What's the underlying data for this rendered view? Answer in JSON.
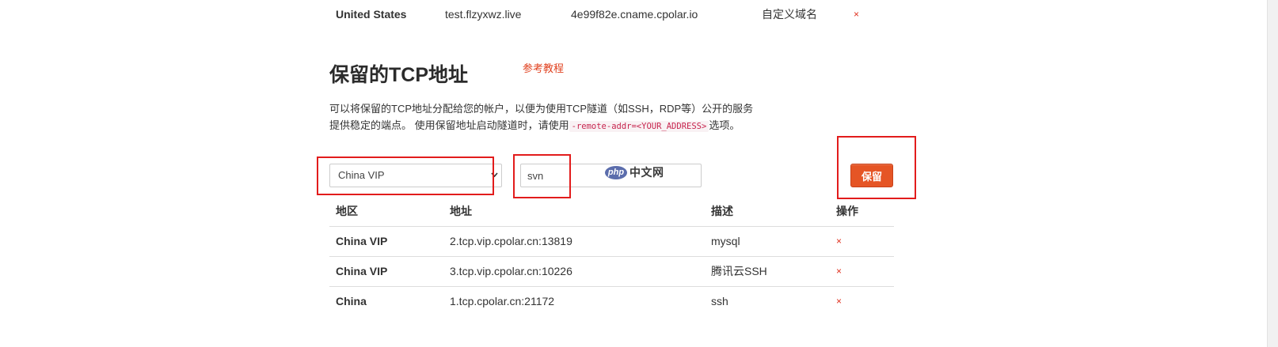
{
  "prev_section": {
    "row": {
      "region": "United States",
      "domain": "test.flzyxwz.live",
      "cname": "4e99f82e.cname.cpolar.io",
      "type": "自定义域名",
      "delete": "×"
    }
  },
  "section": {
    "title": "保留的TCP地址",
    "tutorial_link": "参考教程",
    "description_line1": "可以将保留的TCP地址分配给您的帐户，以便为使用TCP隧道（如SSH，RDP等）公开的服务",
    "description_line2_prefix": "提供稳定的端点。 使用保留地址启动隧道时，请使用",
    "description_code": "-remote-addr=<YOUR_ADDRESS>",
    "description_line2_suffix": "选项。"
  },
  "form": {
    "region_select": "China VIP",
    "description_input": "svn",
    "save_label": "保留"
  },
  "watermark": {
    "logo": "php",
    "text": "中文网"
  },
  "table": {
    "headers": [
      "地区",
      "地址",
      "描述",
      "操作"
    ],
    "rows": [
      {
        "region": "China VIP",
        "address": "2.tcp.vip.cpolar.cn:13819",
        "desc": "mysql",
        "action": "×"
      },
      {
        "region": "China VIP",
        "address": "3.tcp.vip.cpolar.cn:10226",
        "desc": "腾讯云SSH",
        "action": "×"
      },
      {
        "region": "China",
        "address": "1.tcp.cpolar.cn:21172",
        "desc": "ssh",
        "action": "×"
      }
    ]
  },
  "colors": {
    "accent": "#e55525",
    "delete": "#e0301e",
    "annotation": "#e21c1c"
  }
}
